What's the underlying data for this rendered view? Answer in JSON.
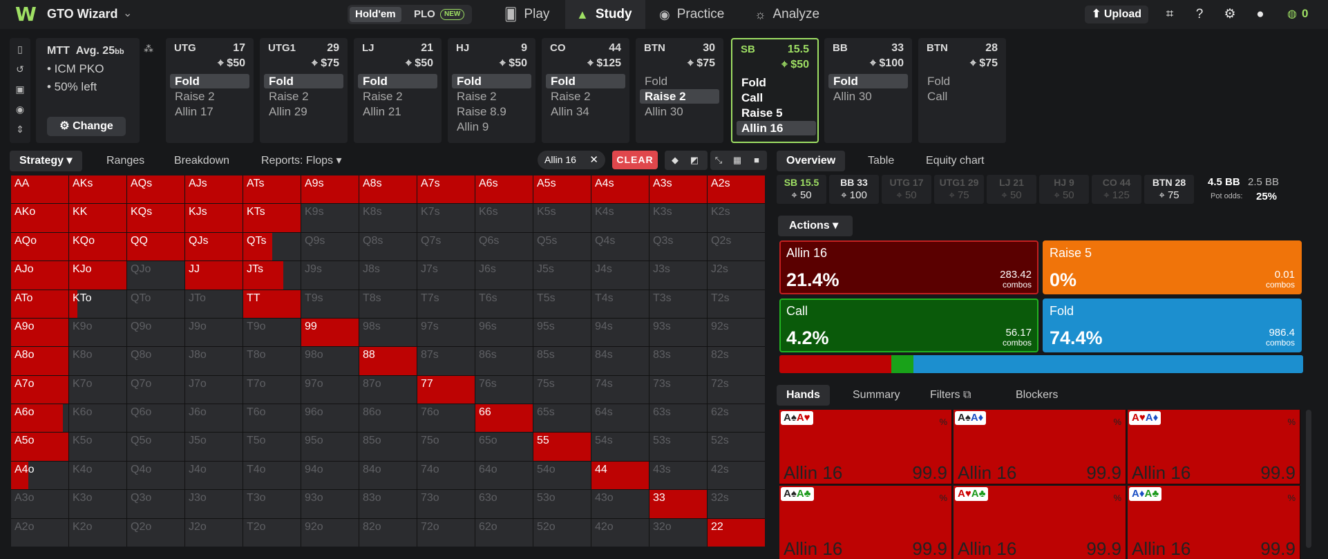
{
  "app": {
    "name": "GTO Wizard",
    "balance": "0"
  },
  "game_toggle": {
    "holdem": "Hold'em",
    "plo": "PLO",
    "new_badge": "NEW"
  },
  "nav": {
    "play": "Play",
    "study": "Study",
    "practice": "Practice",
    "analyze": "Analyze"
  },
  "topbar": {
    "upload": "Upload"
  },
  "info": {
    "format": "MTT",
    "avg": "Avg. 25",
    "avg_unit": "bb",
    "line1": "• ICM PKO",
    "line2": "• 50% left",
    "change": "Change"
  },
  "seats": [
    {
      "pos": "UTG",
      "stack": "17",
      "bounty": "$50",
      "actions": [
        "Fold",
        "Raise 2",
        "Allin 17"
      ],
      "selected": 0
    },
    {
      "pos": "UTG1",
      "stack": "29",
      "bounty": "$75",
      "actions": [
        "Fold",
        "Raise 2",
        "Allin 29"
      ],
      "selected": 0
    },
    {
      "pos": "LJ",
      "stack": "21",
      "bounty": "$50",
      "actions": [
        "Fold",
        "Raise 2",
        "Allin 21"
      ],
      "selected": 0
    },
    {
      "pos": "HJ",
      "stack": "9",
      "bounty": "$50",
      "actions": [
        "Fold",
        "Raise 2",
        "Raise 8.9",
        "Allin 9"
      ],
      "selected": 0
    },
    {
      "pos": "CO",
      "stack": "44",
      "bounty": "$125",
      "actions": [
        "Fold",
        "Raise 2",
        "Allin 34"
      ],
      "selected": 0
    },
    {
      "pos": "BTN",
      "stack": "30",
      "bounty": "$75",
      "actions": [
        "Fold",
        "Raise 2",
        "Allin 30"
      ],
      "selected": 1
    },
    {
      "pos": "SB",
      "stack": "15.5",
      "bounty": "$50",
      "actions": [
        "Fold",
        "Call",
        "Raise 5",
        "Allin 16"
      ],
      "selected": 3,
      "active": true
    },
    {
      "pos": "BB",
      "stack": "33",
      "bounty": "$100",
      "actions": [
        "Fold",
        "Allin 30"
      ],
      "selected": 0
    },
    {
      "pos": "BTN",
      "stack": "28",
      "bounty": "$75",
      "actions": [
        "Fold",
        "Call"
      ],
      "selected": -1
    }
  ],
  "left_tabs": {
    "strategy": "Strategy",
    "ranges": "Ranges",
    "breakdown": "Breakdown",
    "reports": "Reports: Flops"
  },
  "filter_chip": "Allin 16",
  "clear": "CLEAR",
  "matrix": {
    "rows": [
      [
        "AA",
        "AKs",
        "AQs",
        "AJs",
        "ATs",
        "A9s",
        "A8s",
        "A7s",
        "A6s",
        "A5s",
        "A4s",
        "A3s",
        "A2s"
      ],
      [
        "AKo",
        "KK",
        "KQs",
        "KJs",
        "KTs",
        "K9s",
        "K8s",
        "K7s",
        "K6s",
        "K5s",
        "K4s",
        "K3s",
        "K2s"
      ],
      [
        "AQo",
        "KQo",
        "QQ",
        "QJs",
        "QTs",
        "Q9s",
        "Q8s",
        "Q7s",
        "Q6s",
        "Q5s",
        "Q4s",
        "Q3s",
        "Q2s"
      ],
      [
        "AJo",
        "KJo",
        "QJo",
        "JJ",
        "JTs",
        "J9s",
        "J8s",
        "J7s",
        "J6s",
        "J5s",
        "J4s",
        "J3s",
        "J2s"
      ],
      [
        "ATo",
        "KTo",
        "QTo",
        "JTo",
        "TT",
        "T9s",
        "T8s",
        "T7s",
        "T6s",
        "T5s",
        "T4s",
        "T3s",
        "T2s"
      ],
      [
        "A9o",
        "K9o",
        "Q9o",
        "J9o",
        "T9o",
        "99",
        "98s",
        "97s",
        "96s",
        "95s",
        "94s",
        "93s",
        "92s"
      ],
      [
        "A8o",
        "K8o",
        "Q8o",
        "J8o",
        "T8o",
        "98o",
        "88",
        "87s",
        "86s",
        "85s",
        "84s",
        "83s",
        "82s"
      ],
      [
        "A7o",
        "K7o",
        "Q7o",
        "J7o",
        "T7o",
        "97o",
        "87o",
        "77",
        "76s",
        "75s",
        "74s",
        "73s",
        "72s"
      ],
      [
        "A6o",
        "K6o",
        "Q6o",
        "J6o",
        "T6o",
        "96o",
        "86o",
        "76o",
        "66",
        "65s",
        "64s",
        "63s",
        "62s"
      ],
      [
        "A5o",
        "K5o",
        "Q5o",
        "J5o",
        "T5o",
        "95o",
        "85o",
        "75o",
        "65o",
        "55",
        "54s",
        "53s",
        "52s"
      ],
      [
        "A4o",
        "K4o",
        "Q4o",
        "J4o",
        "T4o",
        "94o",
        "84o",
        "74o",
        "64o",
        "54o",
        "44",
        "43s",
        "42s"
      ],
      [
        "A3o",
        "K3o",
        "Q3o",
        "J3o",
        "T3o",
        "93o",
        "83o",
        "73o",
        "63o",
        "53o",
        "43o",
        "33",
        "32s"
      ],
      [
        "A2o",
        "K2o",
        "Q2o",
        "J2o",
        "T2o",
        "92o",
        "82o",
        "72o",
        "62o",
        "52o",
        "42o",
        "32o",
        "22"
      ]
    ],
    "allin_freq": [
      [
        1,
        1,
        1,
        1,
        1,
        1,
        1,
        1,
        1,
        1,
        1,
        1,
        1
      ],
      [
        1,
        1,
        1,
        1,
        1,
        0,
        0,
        0,
        0,
        0,
        0,
        0,
        0
      ],
      [
        1,
        1,
        1,
        1,
        0.5,
        0,
        0,
        0,
        0,
        0,
        0,
        0,
        0
      ],
      [
        1,
        1,
        0,
        1,
        0.7,
        0,
        0,
        0,
        0,
        0,
        0,
        0,
        0
      ],
      [
        1,
        0.15,
        0,
        0,
        1,
        0,
        0,
        0,
        0,
        0,
        0,
        0,
        0
      ],
      [
        1,
        0,
        0,
        0,
        0,
        1,
        0,
        0,
        0,
        0,
        0,
        0,
        0
      ],
      [
        1,
        0,
        0,
        0,
        0,
        0,
        1,
        0,
        0,
        0,
        0,
        0,
        0
      ],
      [
        1,
        0,
        0,
        0,
        0,
        0,
        0,
        1,
        0,
        0,
        0,
        0,
        0
      ],
      [
        0.9,
        0,
        0,
        0,
        0,
        0,
        0,
        0,
        1,
        0,
        0,
        0,
        0
      ],
      [
        1,
        0,
        0,
        0,
        0,
        0,
        0,
        0,
        0,
        1,
        0,
        0,
        0
      ],
      [
        0.3,
        0,
        0,
        0,
        0,
        0,
        0,
        0,
        0,
        0,
        1,
        0,
        0
      ],
      [
        0,
        0,
        0,
        0,
        0,
        0,
        0,
        0,
        0,
        0,
        0,
        1,
        0
      ],
      [
        0,
        0,
        0,
        0,
        0,
        0,
        0,
        0,
        0,
        0,
        0,
        0,
        1
      ]
    ]
  },
  "right_tabs": {
    "overview": "Overview",
    "table": "Table",
    "equity": "Equity chart"
  },
  "seat_chips": [
    {
      "a": "SB 15.5",
      "b": "50",
      "me": true
    },
    {
      "a": "BB 33",
      "b": "100",
      "hl": true
    },
    {
      "a": "UTG 17",
      "b": "50"
    },
    {
      "a": "UTG1 29",
      "b": "75"
    },
    {
      "a": "LJ 21",
      "b": "50"
    },
    {
      "a": "HJ 9",
      "b": "50"
    },
    {
      "a": "CO 44",
      "b": "125"
    },
    {
      "a": "BTN 28",
      "b": "75",
      "hl": true
    }
  ],
  "pot": {
    "bb": "4.5 BB",
    "bb2": "2.5 BB",
    "odds_label": "Pot odds:",
    "odds": "25%"
  },
  "actions_btn": "Actions",
  "action_cards": [
    {
      "name": "Allin 16",
      "pct": "21.4%",
      "combos": "283.42",
      "unit": "combos",
      "bg": "#5a0000",
      "border": "#c51f1f"
    },
    {
      "name": "Raise 5",
      "pct": "0%",
      "combos": "0.01",
      "unit": "combos",
      "bg": "#f0740a",
      "border": "#f0740a"
    },
    {
      "name": "Call",
      "pct": "4.2%",
      "combos": "56.17",
      "unit": "combos",
      "bg": "#0a5a0a",
      "border": "#22b422"
    },
    {
      "name": "Fold",
      "pct": "74.4%",
      "combos": "986.4",
      "unit": "combos",
      "bg": "#1c8fcf",
      "border": "#1c8fcf"
    }
  ],
  "freq_bar": [
    {
      "label": "Allin 16",
      "value": 21.4,
      "color": "#bd0303"
    },
    {
      "label": "Call",
      "value": 4.2,
      "color": "#19a219"
    },
    {
      "label": "Fold",
      "value": 74.4,
      "color": "#1c8fcf"
    }
  ],
  "bottom_tabs": {
    "hands": "Hands",
    "summary": "Summary",
    "filters": "Filters",
    "blockers": "Blockers"
  },
  "hands": [
    {
      "c1": "A♠",
      "c2": "A♥",
      "c1c": "#222",
      "c2c": "#c00",
      "pct": "%",
      "action": "Allin 16",
      "value": "99.9"
    },
    {
      "c1": "A♠",
      "c2": "A♦",
      "c1c": "#222",
      "c2c": "#1a4fc4",
      "pct": "%",
      "action": "Allin 16",
      "value": "99.9"
    },
    {
      "c1": "A♥",
      "c2": "A♦",
      "c1c": "#c00",
      "c2c": "#1a4fc4",
      "pct": "%",
      "action": "Allin 16",
      "value": "99.9"
    },
    {
      "c1": "A♠",
      "c2": "A♣",
      "c1c": "#222",
      "c2c": "#1a9a1a",
      "pct": "%",
      "action": "Allin 16",
      "value": "99.9"
    },
    {
      "c1": "A♥",
      "c2": "A♣",
      "c1c": "#c00",
      "c2c": "#1a9a1a",
      "pct": "%",
      "action": "Allin 16",
      "value": "99.9"
    },
    {
      "c1": "A♦",
      "c2": "A♣",
      "c1c": "#1a4fc4",
      "c2c": "#1a9a1a",
      "pct": "%",
      "action": "Allin 16",
      "value": "99.9"
    }
  ]
}
